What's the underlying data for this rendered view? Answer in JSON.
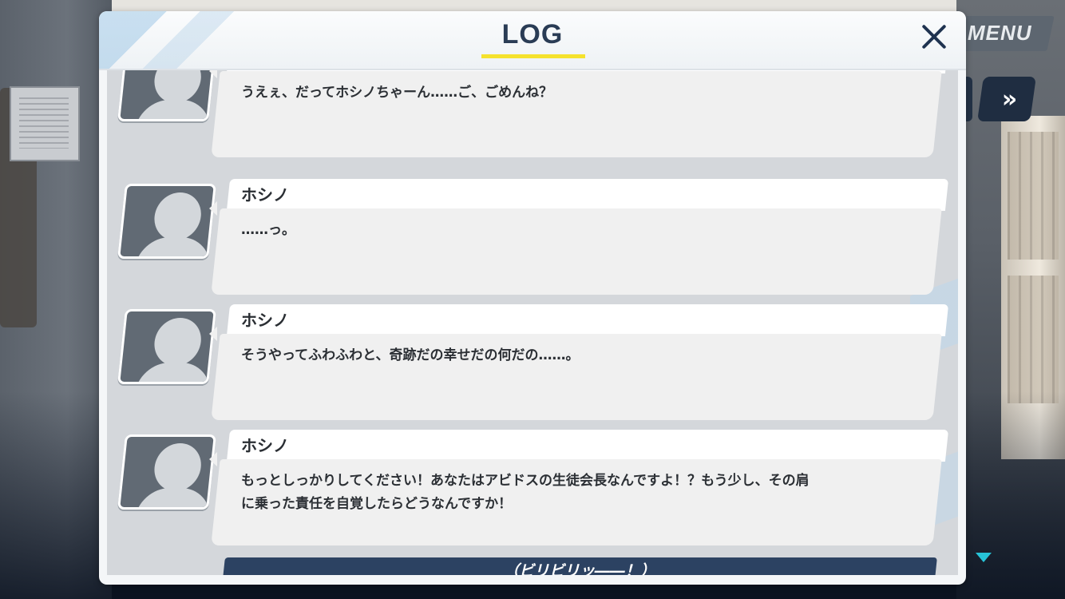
{
  "hud": {
    "menu_label": "MENU",
    "skip_icon": "»"
  },
  "log": {
    "title": "LOG",
    "close_icon": "close-icon"
  },
  "entries": [
    {
      "speaker": "",
      "text": "うえぇ、だってホシノちゃーん……ご、ごめんね？"
    },
    {
      "speaker": "ホシノ",
      "text": "……っ。"
    },
    {
      "speaker": "ホシノ",
      "text": "そうやってふわふわと、奇跡だの幸せだの何だの……。"
    },
    {
      "speaker": "ホシノ",
      "text": "もっとしっかりしてください！あなたはアビドスの生徒会長なんですよ！？もう少し、その肩\nに乗った責任を自覚したらどうなんですか！"
    }
  ],
  "next_entry": {
    "text": "（ビリビリッ――！）"
  },
  "colors": {
    "title_underline": "#f5e22d",
    "scroll_arrow": "#27c3d8",
    "sfx_bar": "#2c4262"
  }
}
